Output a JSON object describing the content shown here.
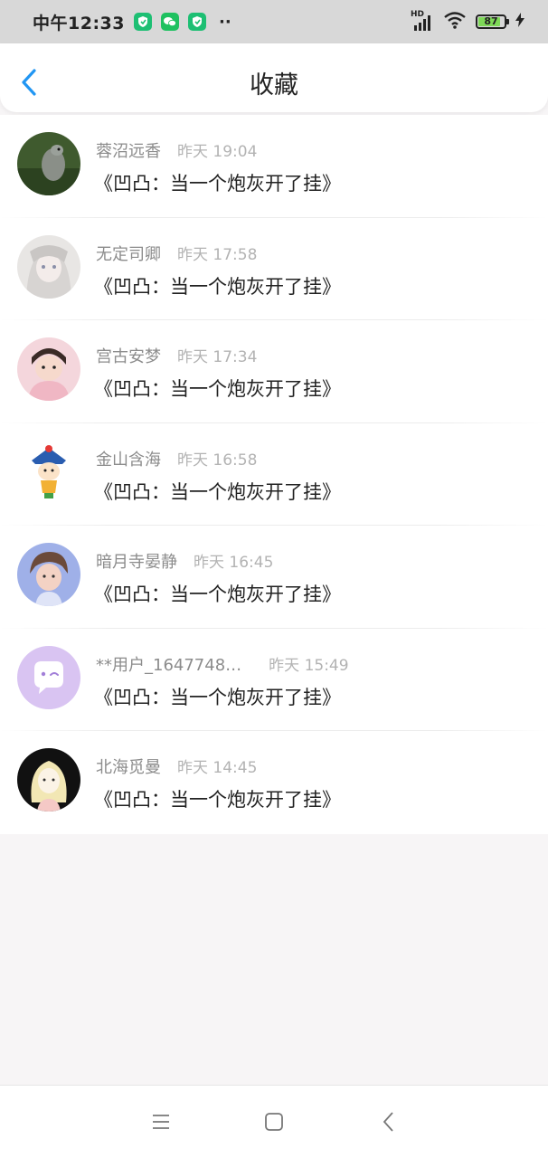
{
  "status_bar": {
    "time": "中午12:33",
    "network": "HD",
    "battery": "87",
    "battery_level": 0.87,
    "icons": [
      "shield-app-icon",
      "wechat-icon",
      "shield-app-icon",
      "more-dots-icon",
      "signal-icon",
      "wifi-icon",
      "battery-icon",
      "charging-icon"
    ]
  },
  "header": {
    "title": "收藏",
    "back_icon": "chevron-left-icon",
    "accent": "#2196f3"
  },
  "favorites": [
    {
      "user": "蓉沼远香",
      "time": "昨天 19:04",
      "book": "《凹凸：当一个炮灰开了挂》"
    },
    {
      "user": "无定司卿",
      "time": "昨天 17:58",
      "book": "《凹凸：当一个炮灰开了挂》"
    },
    {
      "user": "宫古安梦",
      "time": "昨天 17:34",
      "book": "《凹凸：当一个炮灰开了挂》"
    },
    {
      "user": "金山含海",
      "time": "昨天 16:58",
      "book": "《凹凸：当一个炮灰开了挂》"
    },
    {
      "user": "暗月寺晏静",
      "time": "昨天 16:45",
      "book": "《凹凸：当一个炮灰开了挂》"
    },
    {
      "user": "**用户_1647748…",
      "time": "昨天 15:49",
      "book": "《凹凸：当一个炮灰开了挂》"
    },
    {
      "user": "北海觅曼",
      "time": "昨天 14:45",
      "book": "《凹凸：当一个炮灰开了挂》"
    }
  ],
  "nav_bar": {
    "icons": [
      "menu-icon",
      "home-square-icon",
      "back-chevron-icon"
    ]
  }
}
